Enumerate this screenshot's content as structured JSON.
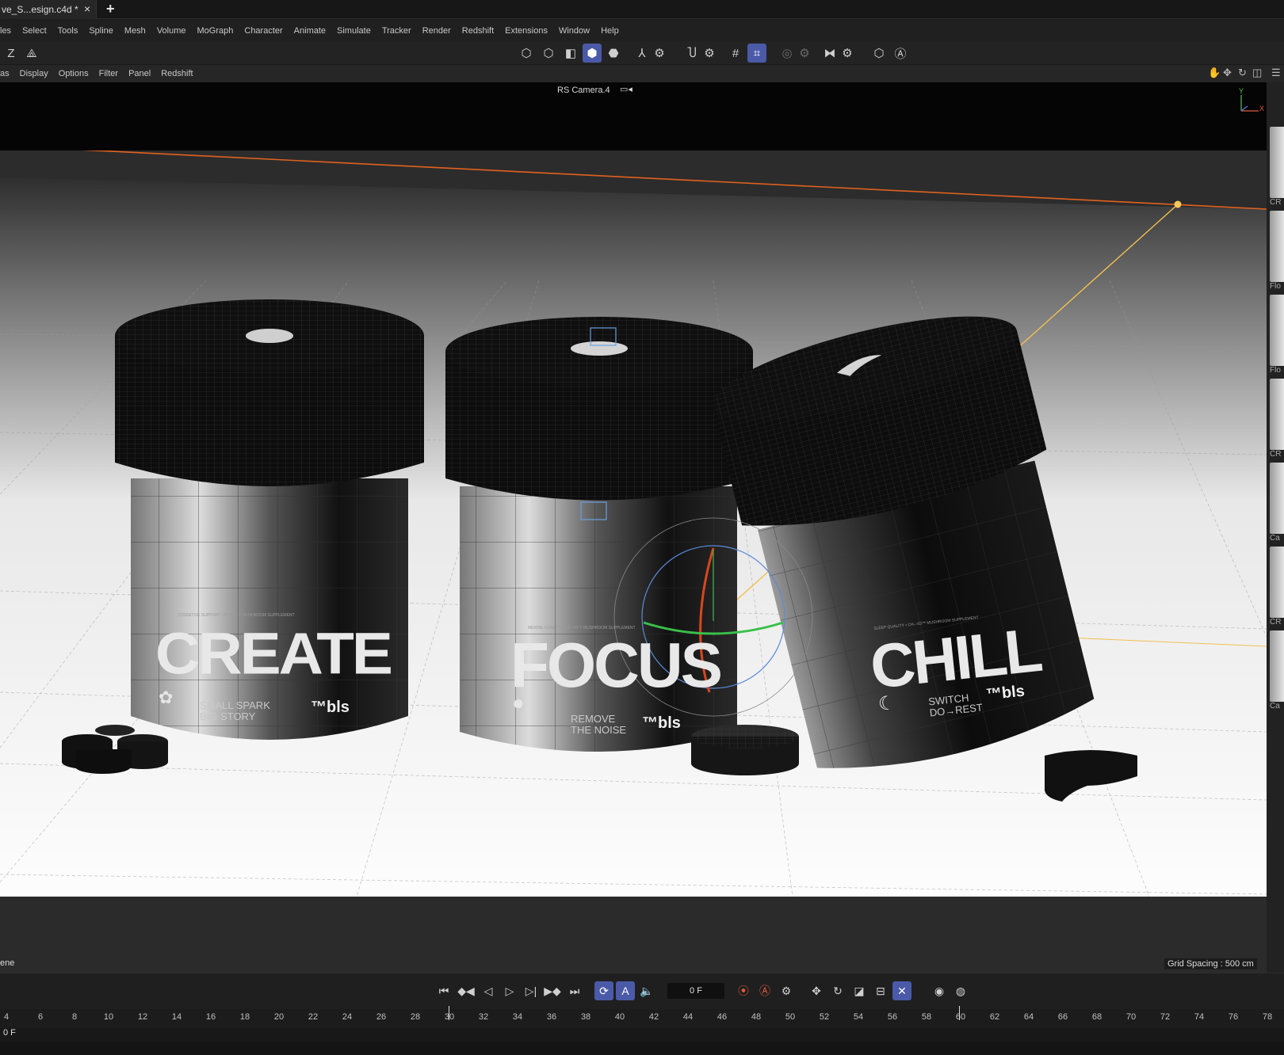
{
  "tab": {
    "title": "ve_S...esign.c4d *",
    "close": "×",
    "add": "+"
  },
  "menu": [
    "les",
    "Select",
    "Tools",
    "Spline",
    "Mesh",
    "Volume",
    "MoGraph",
    "Character",
    "Animate",
    "Simulate",
    "Tracker",
    "Render",
    "Redshift",
    "Extensions",
    "Window",
    "Help"
  ],
  "toolbar": {
    "z_label": "Z"
  },
  "viewport_menu": [
    "as",
    "Display",
    "Options",
    "Filter",
    "Panel",
    "Redshift"
  ],
  "viewport": {
    "camera": "RS Camera.4",
    "axis_y": "Y",
    "axis_x": "X",
    "scene_label": "ene",
    "grid_spacing": "Grid Spacing : 500 cm"
  },
  "products": [
    {
      "name": "CREATE",
      "line": "COGNITIVE SUPPORT • CT—01™ MUSHROOM SUPPLEMENT",
      "tag1": "SMALL SPARK",
      "tag2": "BIG STORY",
      "brand": "™bls"
    },
    {
      "name": "FOCUS",
      "line": "MENTAL CLARITY • FS—02™ MUSHROOM SUPPLEMENT",
      "tag1": "REMOVE",
      "tag2": "THE NOISE",
      "brand": "™bls"
    },
    {
      "name": "CHILL",
      "line": "SLEEP QUALITY • CH—03™ MUSHROOM SUPPLEMENT",
      "tag1": "SWITCH",
      "tag2": "DO→REST",
      "brand": "™bls"
    }
  ],
  "right_panel": [
    "CR",
    "Flo",
    "Flo",
    "CR",
    "Ca",
    "CR",
    "Ca"
  ],
  "timeline": {
    "frame": "0 F",
    "status_frame": "0 F"
  },
  "ruler": [
    "4",
    "6",
    "8",
    "10",
    "12",
    "14",
    "16",
    "18",
    "20",
    "22",
    "24",
    "26",
    "28",
    "30",
    "32",
    "34",
    "36",
    "38",
    "40",
    "42",
    "44",
    "46",
    "48",
    "50",
    "52",
    "54",
    "56",
    "58",
    "60",
    "62",
    "64",
    "66",
    "68",
    "70",
    "72",
    "74",
    "76",
    "78"
  ],
  "colors": {
    "accent": "#4a5aa8",
    "orange_line": "#e0621e",
    "light_line": "#f0c050"
  }
}
